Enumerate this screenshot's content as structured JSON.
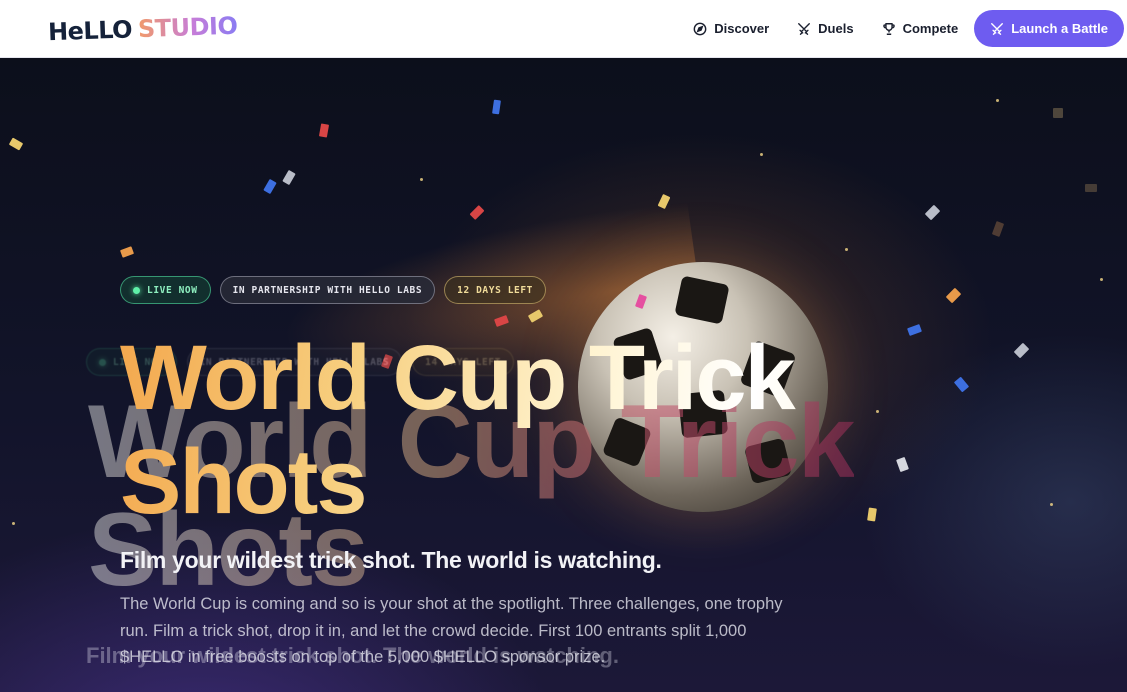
{
  "brand": {
    "part1": "HeLLO",
    "part2": "STUDIO"
  },
  "nav": {
    "links": [
      {
        "label": "Discover",
        "icon": "compass-icon"
      },
      {
        "label": "Duels",
        "icon": "crossed-swords-icon"
      },
      {
        "label": "Compete",
        "icon": "trophy-icon"
      }
    ],
    "cta": {
      "label": "Launch a Battle",
      "icon": "crossed-swords-icon"
    }
  },
  "hero": {
    "badges": {
      "live": "LIVE NOW",
      "partner": "IN PARTNERSHIP WITH HELLO LABS",
      "days": "12 DAYS LEFT"
    },
    "title_line1": "World Cup Trick",
    "title_line2": "Shots",
    "subtitle": "Film your wildest trick shot. The world is watching.",
    "body": "The World Cup is coming and so is your shot at the spotlight. Three challenges, one trophy run. Film a trick shot, drop it in, and let the crowd decide. First 100 entrants split 1,000 $HELLO in free boosts on top of the 5,000 $HELLO sponsor prize."
  },
  "ghost": {
    "badge_live": "LIVE NOW",
    "badge_partner": "IN PARTNERSHIP WITH HELLO LABS",
    "badge_days": "14 DAYS LEFT",
    "title_line1": "World Cup Trick",
    "title_line2": "Shots",
    "subtitle": "Film your wildest trick shot. The world is watching."
  },
  "colors": {
    "accent": "#6e5cf0",
    "live_green": "#5ff0a8",
    "navy": "#15223a"
  }
}
